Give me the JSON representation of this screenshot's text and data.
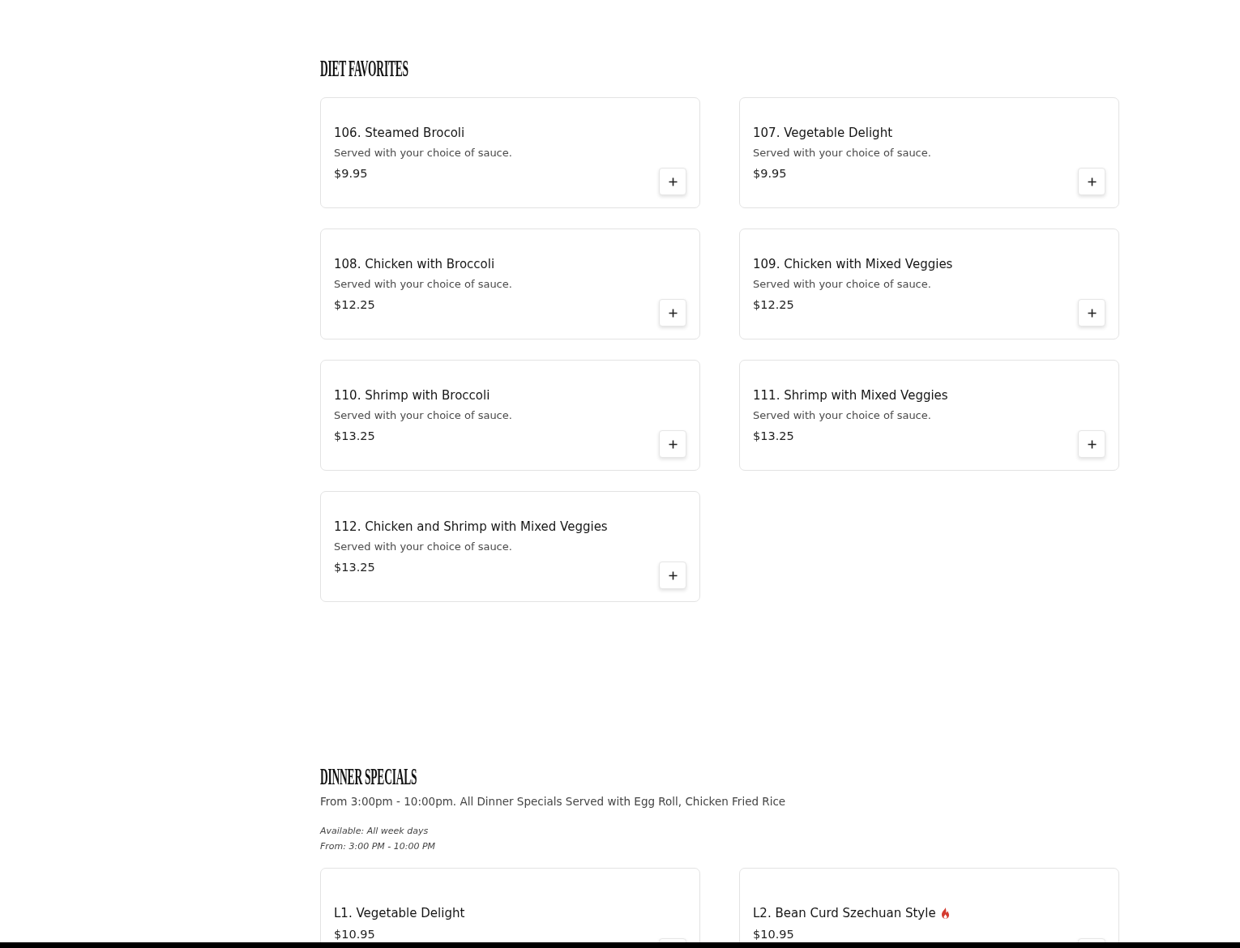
{
  "sections": [
    {
      "title": "DIET FAVORITES",
      "items": [
        {
          "name": "106. Steamed Brocoli",
          "description": "Served with your choice of sauce.",
          "price": "$9.95",
          "spicy": false
        },
        {
          "name": "107. Vegetable Delight",
          "description": "Served with your choice of sauce.",
          "price": "$9.95",
          "spicy": false
        },
        {
          "name": "108. Chicken with Broccoli",
          "description": "Served with your choice of sauce.",
          "price": "$12.25",
          "spicy": false
        },
        {
          "name": "109. Chicken with Mixed Veggies",
          "description": "Served with your choice of sauce.",
          "price": "$12.25",
          "spicy": false
        },
        {
          "name": "110. Shrimp with Broccoli",
          "description": "Served with your choice of sauce.",
          "price": "$13.25",
          "spicy": false
        },
        {
          "name": "111. Shrimp with Mixed Veggies",
          "description": "Served with your choice of sauce.",
          "price": "$13.25",
          "spicy": false
        },
        {
          "name": "112. Chicken and Shrimp with Mixed Veggies",
          "description": "Served with your choice of sauce.",
          "price": "$13.25",
          "spicy": false
        }
      ]
    },
    {
      "title": "DINNER SPECIALS",
      "description": "From 3:00pm - 10:00pm. All Dinner Specials Served with Egg Roll, Chicken Fried Rice",
      "availability": [
        "Available: All week days",
        "From: 3:00 PM - 10:00 PM"
      ],
      "items": [
        {
          "name": "L1. Vegetable Delight",
          "price": "$10.95",
          "spicy": false
        },
        {
          "name": "L2. Bean Curd Szechuan Style",
          "price": "$10.95",
          "spicy": true
        }
      ]
    }
  ]
}
